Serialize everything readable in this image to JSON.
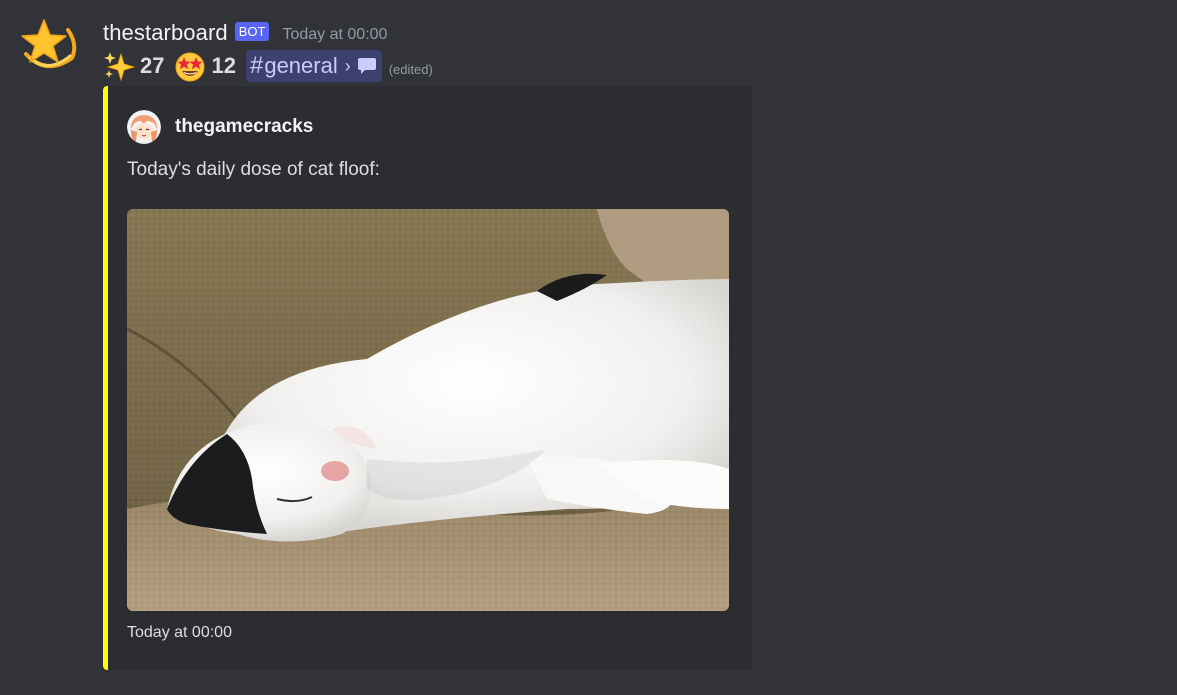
{
  "message": {
    "username": "thestarboard",
    "bot_badge": "BOT",
    "timestamp": "Today at 00:00",
    "reactions": [
      {
        "emoji": "sparkles-icon",
        "count": "27"
      },
      {
        "emoji": "star-struck-icon",
        "count": "12"
      }
    ],
    "channel": {
      "hash": "#",
      "name": "general",
      "separator": "›",
      "thread_icon": "speech-bubble-icon"
    },
    "edited_label": "(edited)"
  },
  "embed": {
    "accent_color": "#ffff00",
    "author": {
      "name": "thegamecracks"
    },
    "description": "Today's daily dose of cat floof:",
    "image_alt": "black and white cat sleeping on a couch",
    "footer": "Today at 00:00"
  },
  "colors": {
    "background": "#313338",
    "embed_background": "#2b2d31",
    "bot_badge": "#5865f2",
    "mention_text": "#c9cdfb"
  }
}
